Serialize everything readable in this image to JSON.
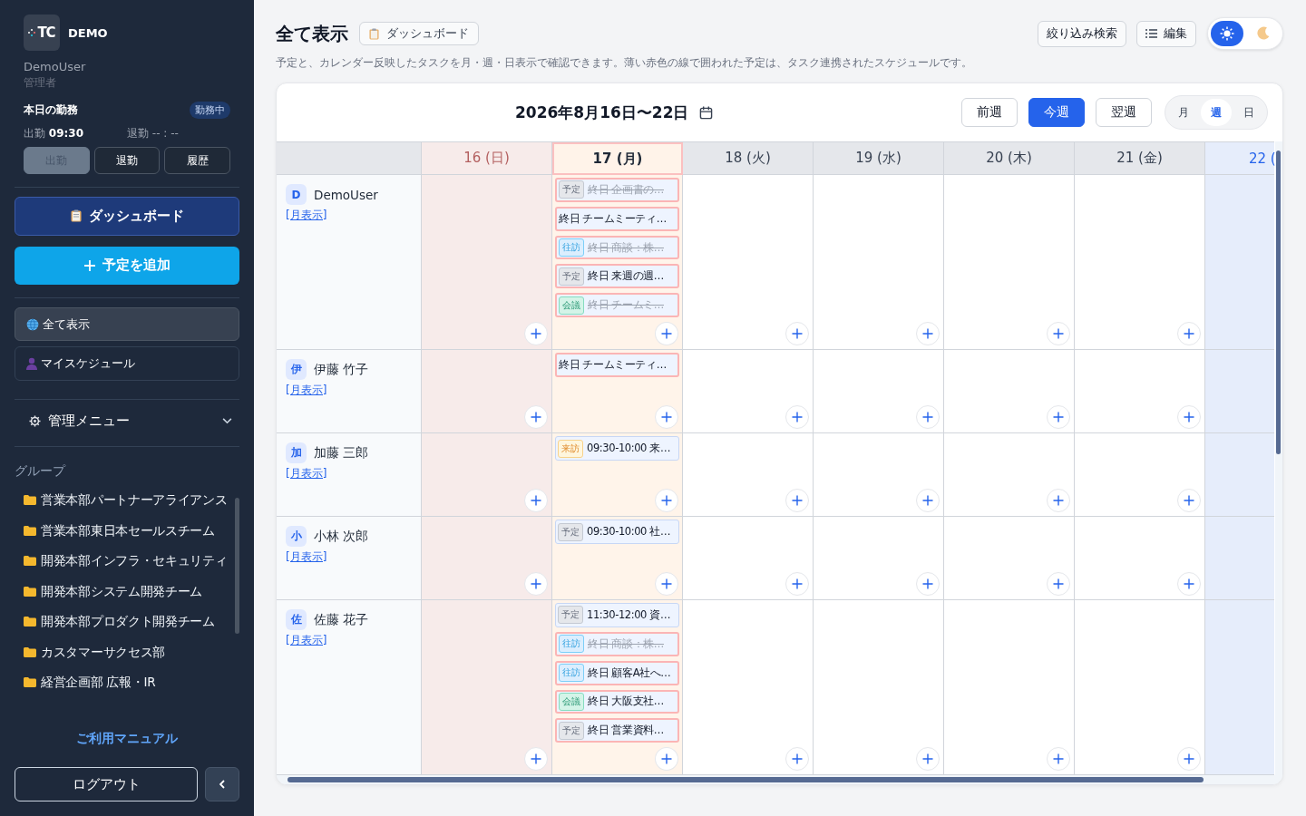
{
  "sidebar": {
    "logo_text": "TC",
    "brand": "DEMO",
    "user": "DemoUser",
    "role": "管理者",
    "attendance": {
      "title": "本日の勤務",
      "status": "勤務中",
      "in_label": "出勤",
      "in_time": "09:30",
      "out_label": "退勤",
      "out_time": "-- : --",
      "buttons": [
        {
          "label": "出勤",
          "disabled": true
        },
        {
          "label": "退勤",
          "disabled": false
        },
        {
          "label": "履歴",
          "disabled": false
        }
      ]
    },
    "dashboard_button": "ダッシュボード",
    "add_button": "予定を追加",
    "nav": [
      {
        "label": "全て表示",
        "selected": true
      },
      {
        "label": "マイスケジュール",
        "selected": false
      }
    ],
    "admin_menu": {
      "label": "管理メニュー",
      "expanded": false
    },
    "groups_title": "グループ",
    "groups": [
      "営業本部パートナーアライアンス",
      "営業本部東日本セールスチーム",
      "開発本部インフラ・セキュリティ",
      "開発本部システム開発チーム",
      "開発本部プロダクト開発チーム",
      "カスタマーサクセス部",
      "経営企画部 広報・IR"
    ],
    "manual_link": "ご利用マニュアル",
    "logout": "ログアウト"
  },
  "header": {
    "title": "全て表示",
    "dashboard_chip": "ダッシュボード",
    "filter_button": "絞り込み検索",
    "edit_button": "編集",
    "theme_options": [
      {
        "kind": "sun",
        "selected": true
      },
      {
        "kind": "moon",
        "selected": false
      }
    ],
    "description": "予定と、カレンダー反映したタスクを月・週・日表示で確認できます。薄い赤色の線で囲われた予定は、タスク連携されたスケジュールです。"
  },
  "calendar": {
    "range": "2026年8月16日〜22日",
    "nav": [
      {
        "label": "前週",
        "selected": false
      },
      {
        "label": "今週",
        "selected": true
      },
      {
        "label": "翌週",
        "selected": false
      }
    ],
    "views": [
      {
        "label": "月",
        "selected": false
      },
      {
        "label": "週",
        "selected": true
      },
      {
        "label": "日",
        "selected": false
      }
    ],
    "days": [
      {
        "label": "16 (日)",
        "kind": "sunday"
      },
      {
        "label": "17 (月)",
        "kind": "today"
      },
      {
        "label": "18 (火)",
        "kind": "weekday"
      },
      {
        "label": "19 (水)",
        "kind": "weekday"
      },
      {
        "label": "20 (木)",
        "kind": "weekday"
      },
      {
        "label": "21 (金)",
        "kind": "weekday"
      },
      {
        "label": "22 (",
        "kind": "saturday"
      }
    ],
    "members": [
      {
        "initial": "D",
        "name": "DemoUser",
        "link": "[月表示]",
        "cells": [
          {
            "add": true
          },
          {
            "add": true,
            "events": [
              {
                "tag": "予定",
                "kind": "plan",
                "time": "終日",
                "title": "企画書の…",
                "done": true,
                "linked": true
              },
              {
                "time": "終日",
                "title": "チームミーティ…",
                "done": false,
                "linked": true
              },
              {
                "tag": "往訪",
                "kind": "visit",
                "time": "終日",
                "title": "商談：株…",
                "done": true,
                "linked": true
              },
              {
                "tag": "予定",
                "kind": "plan",
                "time": "終日",
                "title": "来週の週…",
                "done": false,
                "linked": true
              },
              {
                "tag": "会議",
                "kind": "meeting",
                "time": "終日",
                "title": "チームミ…",
                "done": true,
                "linked": true
              }
            ]
          },
          {
            "add": true
          },
          {
            "add": true
          },
          {
            "add": true
          },
          {
            "add": true
          },
          {}
        ]
      },
      {
        "initial": "伊",
        "name": "伊藤 竹子",
        "link": "[月表示]",
        "cells": [
          {
            "add": true
          },
          {
            "add": true,
            "events": [
              {
                "time": "終日",
                "title": "チームミーティ…",
                "done": false,
                "linked": true
              }
            ]
          },
          {
            "add": true
          },
          {
            "add": true
          },
          {
            "add": true
          },
          {
            "add": true
          },
          {}
        ]
      },
      {
        "initial": "加",
        "name": "加藤 三郎",
        "link": "[月表示]",
        "cells": [
          {
            "add": true
          },
          {
            "add": true,
            "events": [
              {
                "tag": "来訪",
                "kind": "guest",
                "time": "09:30-10:00",
                "title": "来…",
                "done": false,
                "linked": false
              }
            ]
          },
          {
            "add": true
          },
          {
            "add": true
          },
          {
            "add": true
          },
          {
            "add": true
          },
          {}
        ]
      },
      {
        "initial": "小",
        "name": "小林 次郎",
        "link": "[月表示]",
        "cells": [
          {
            "add": true
          },
          {
            "add": true,
            "events": [
              {
                "tag": "予定",
                "kind": "plan",
                "time": "09:30-10:00",
                "title": "社…",
                "done": false,
                "linked": false
              }
            ]
          },
          {
            "add": true
          },
          {
            "add": true
          },
          {
            "add": true
          },
          {
            "add": true
          },
          {}
        ]
      },
      {
        "initial": "佐",
        "name": "佐藤 花子",
        "link": "[月表示]",
        "cells": [
          {
            "add": true
          },
          {
            "add": true,
            "events": [
              {
                "tag": "予定",
                "kind": "plan",
                "time": "11:30-12:00",
                "title": "資…",
                "done": false,
                "linked": false
              },
              {
                "tag": "往訪",
                "kind": "visit",
                "time": "終日",
                "title": "商談：株…",
                "done": true,
                "linked": true
              },
              {
                "tag": "往訪",
                "kind": "visit",
                "time": "終日",
                "title": "顧客A社へ…",
                "done": false,
                "linked": true
              },
              {
                "tag": "会議",
                "kind": "meeting",
                "time": "終日",
                "title": "大阪支社…",
                "done": false,
                "linked": true
              },
              {
                "tag": "予定",
                "kind": "plan",
                "time": "終日",
                "title": "営業資料…",
                "done": false,
                "linked": true
              }
            ]
          },
          {
            "add": true
          },
          {
            "add": true
          },
          {
            "add": true
          },
          {
            "add": true
          },
          {}
        ]
      }
    ]
  }
}
